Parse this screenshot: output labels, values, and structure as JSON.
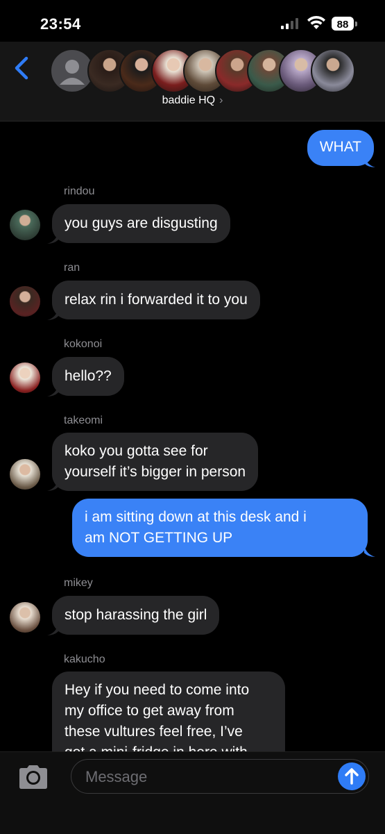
{
  "status_bar": {
    "time": "23:54",
    "battery": "88"
  },
  "header": {
    "group_name": "baddie HQ",
    "chevron": "›"
  },
  "messages": [
    {
      "type": "sent",
      "text": "WHAT"
    },
    {
      "type": "received",
      "sender": "rindou",
      "text": "you guys are disgusting"
    },
    {
      "type": "received",
      "sender": "ran",
      "text": "relax rin i forwarded it to you"
    },
    {
      "type": "received",
      "sender": "kokonoi",
      "text": "hello??"
    },
    {
      "type": "received",
      "sender": "takeomi",
      "lines": [
        "koko you gotta see for",
        "yourself it’s bigger in person"
      ]
    },
    {
      "type": "sent",
      "lines": [
        "i am sitting down at this desk and i",
        "am NOT GETTING UP"
      ]
    },
    {
      "type": "received",
      "sender": "mikey",
      "text": "stop harassing the girl"
    },
    {
      "type": "received",
      "sender": "kakucho",
      "lines": [
        "Hey if you need to come into",
        "my office to get away from",
        "these vultures feel free, I’ve",
        "got a mini-fridge in here with"
      ]
    }
  ],
  "composer": {
    "placeholder": "Message"
  },
  "colors": {
    "sent_bubble": "#3a82f6",
    "received_bubble": "#262628",
    "accent": "#2f7cf6"
  },
  "icons": [
    "chevron-left-icon",
    "camera-icon",
    "send-arrow-icon",
    "signal-icon",
    "wifi-icon",
    "battery-icon"
  ]
}
